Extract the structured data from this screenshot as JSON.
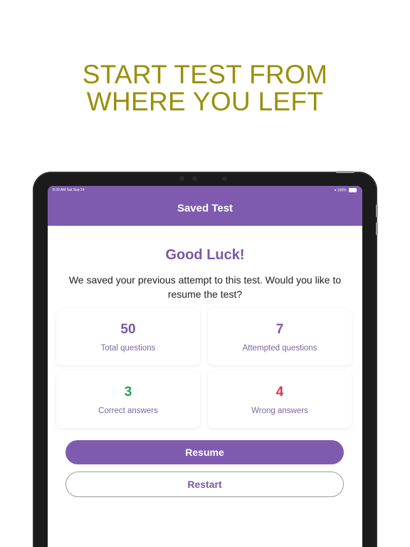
{
  "headline": {
    "line1": "START TEST FROM",
    "line2": "WHERE YOU LEFT"
  },
  "status_bar": {
    "time_date": "8:39 AM   Sat Sep 24",
    "battery": "100%"
  },
  "nav": {
    "title": "Saved Test"
  },
  "content": {
    "greeting": "Good Luck!",
    "description": "We saved your previous attempt to this test. Would you like to resume the test?"
  },
  "stats": [
    {
      "value": "50",
      "label": "Total questions",
      "color": "#7a57a8"
    },
    {
      "value": "7",
      "label": "Attempted questions",
      "color": "#7a57a8"
    },
    {
      "value": "3",
      "label": "Correct answers",
      "color": "#27a05a"
    },
    {
      "value": "4",
      "label": "Wrong answers",
      "color": "#d2394b"
    }
  ],
  "buttons": {
    "resume": "Resume",
    "restart": "Restart"
  },
  "colors": {
    "headline": "#9a8f0a",
    "brand": "#7f5bb0"
  }
}
